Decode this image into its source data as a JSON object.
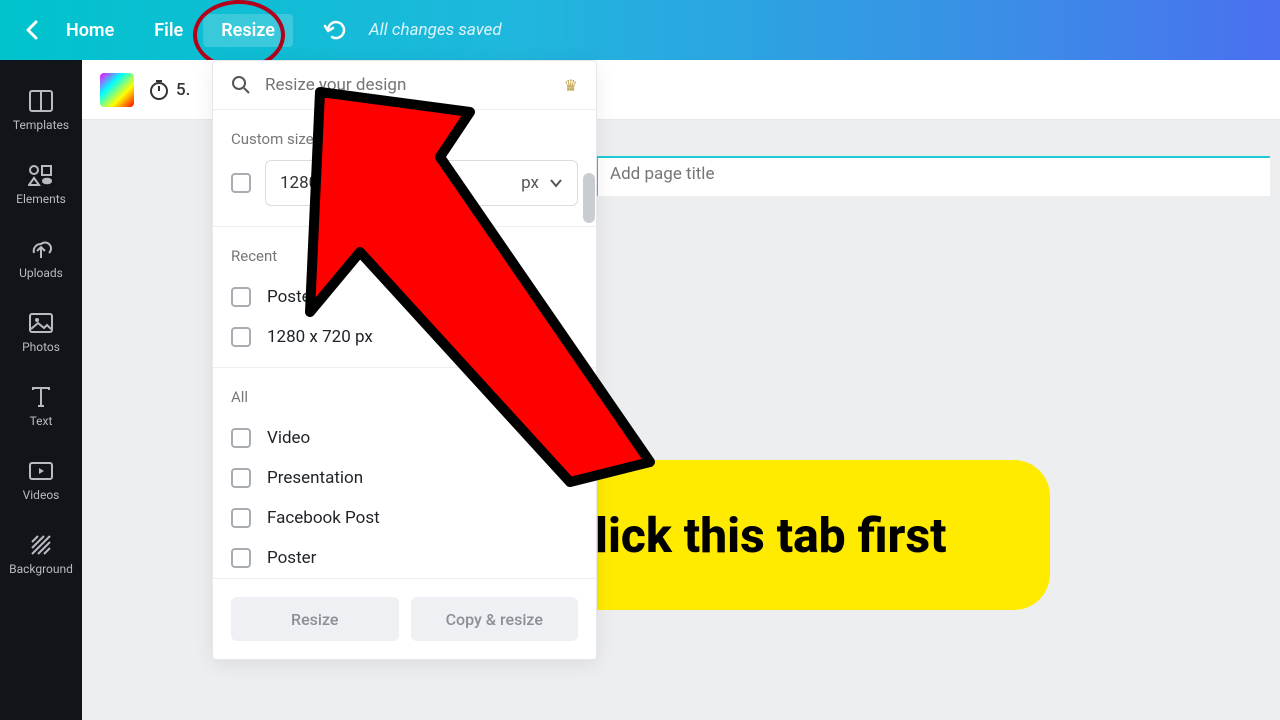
{
  "topbar": {
    "home": "Home",
    "file": "File",
    "resize": "Resize",
    "saved": "All changes saved"
  },
  "sidebar": {
    "items": [
      {
        "label": "Templates"
      },
      {
        "label": "Elements"
      },
      {
        "label": "Uploads"
      },
      {
        "label": "Photos"
      },
      {
        "label": "Text"
      },
      {
        "label": "Videos"
      },
      {
        "label": "Background"
      }
    ]
  },
  "toolbar": {
    "timer_value": "5."
  },
  "panel": {
    "search_placeholder": "Resize your design",
    "custom_label": "Custom size",
    "custom_value": "1280",
    "custom_unit": "px",
    "recent_label": "Recent",
    "recent_items": [
      "Poster",
      "1280 x 720 px"
    ],
    "all_label": "All",
    "all_items": [
      "Video",
      "Presentation",
      "Facebook Post",
      "Poster"
    ],
    "btn_resize": "Resize",
    "btn_copy": "Copy & resize"
  },
  "canvas": {
    "title_placeholder": "Add page title"
  },
  "annotation": {
    "text": "Click this tab first"
  }
}
